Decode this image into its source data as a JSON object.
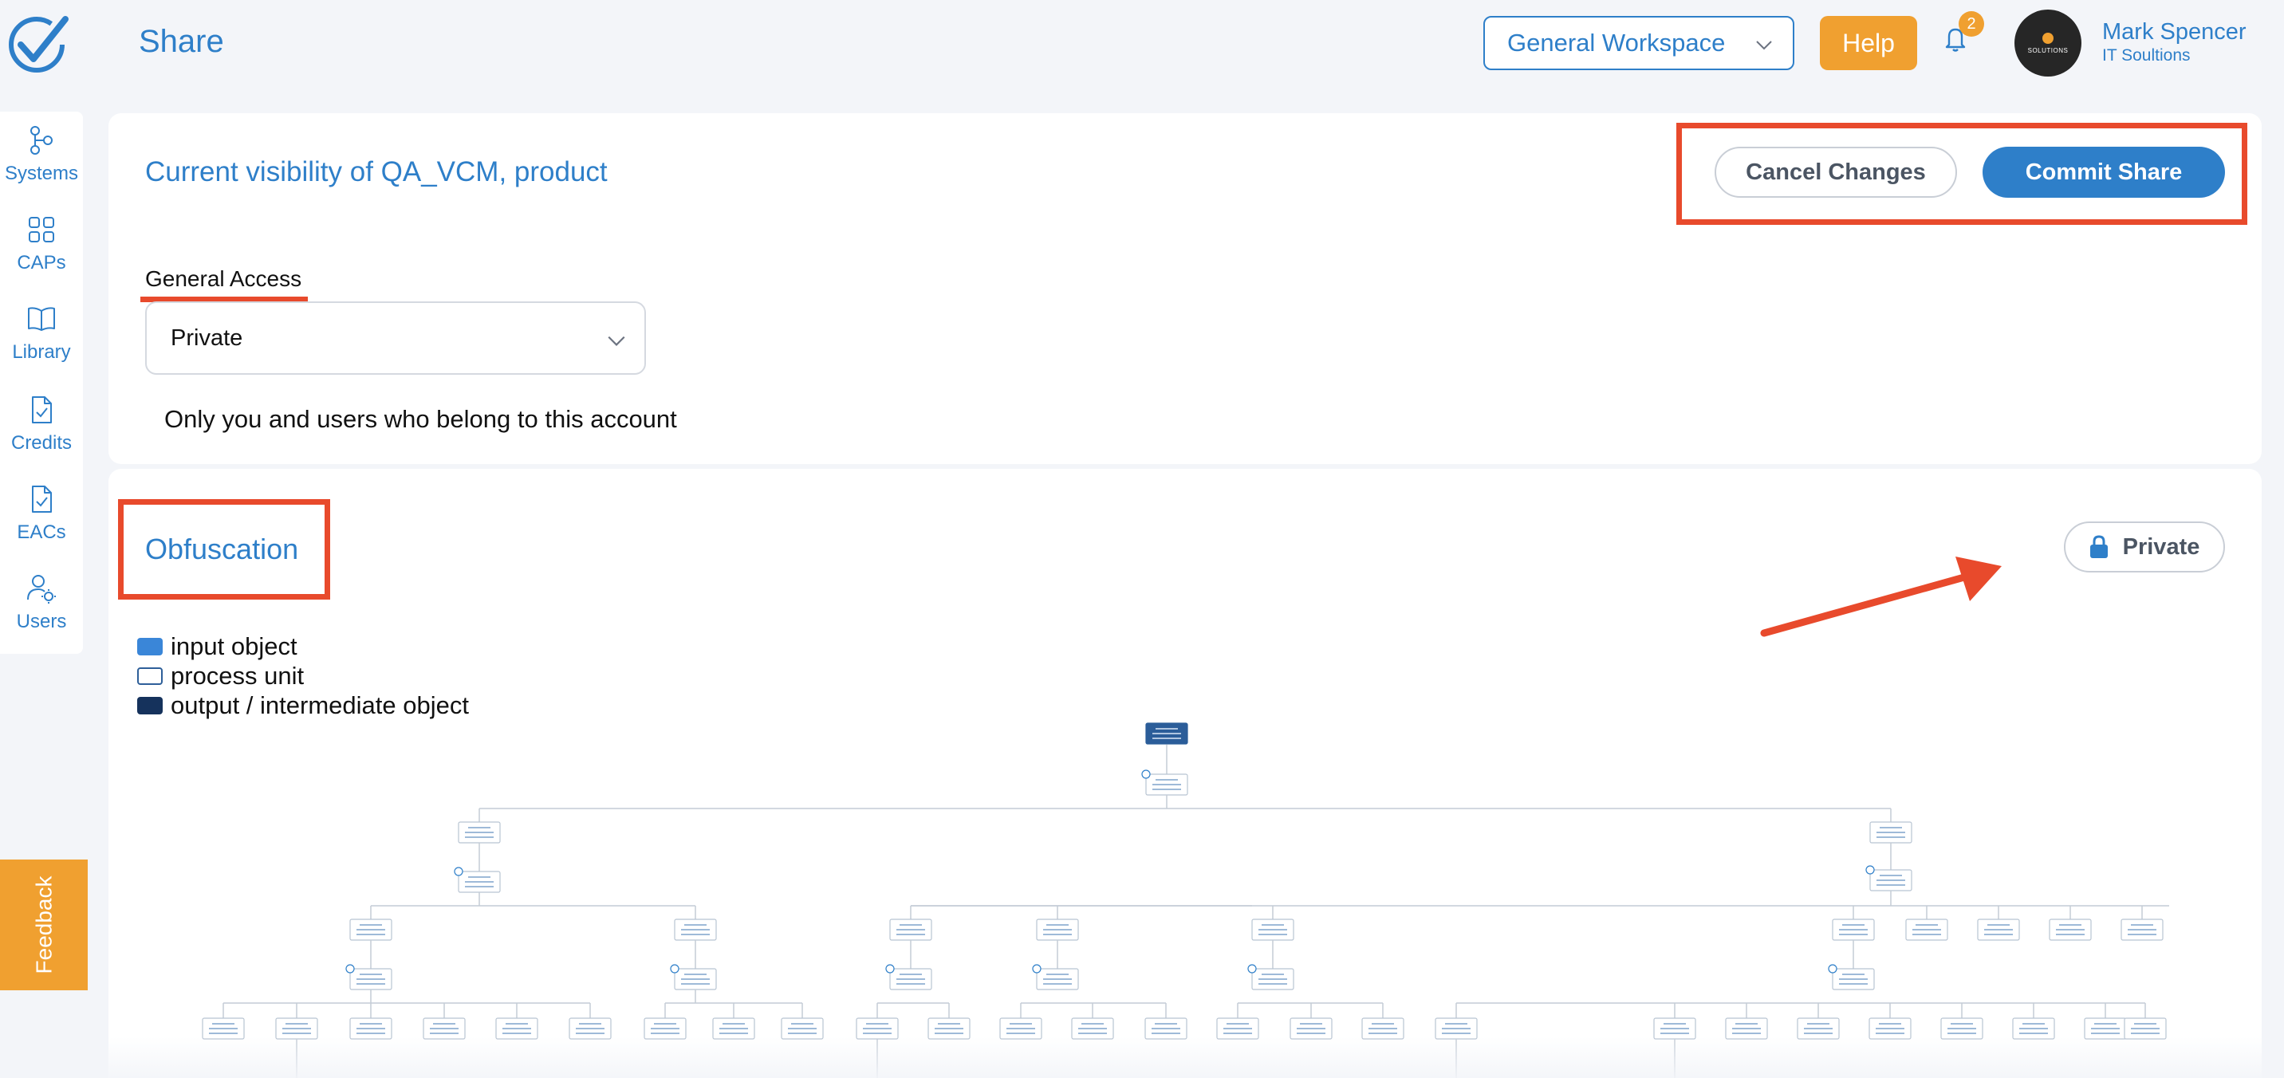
{
  "header": {
    "page_title": "Share",
    "workspace": "General Workspace",
    "help_label": "Help",
    "notification_count": "2",
    "user_name": "Mark Spencer",
    "user_org": "IT Soultions",
    "avatar_text": "SOLUTIONS"
  },
  "sidebar": {
    "items": [
      {
        "label": "Systems",
        "icon": "systems-icon"
      },
      {
        "label": "CAPs",
        "icon": "grid-icon"
      },
      {
        "label": "Library",
        "icon": "book-icon"
      },
      {
        "label": "Credits",
        "icon": "document-check-icon"
      },
      {
        "label": "EACs",
        "icon": "document-check-icon"
      },
      {
        "label": "Users",
        "icon": "user-settings-icon"
      }
    ],
    "feedback_label": "Feedback"
  },
  "visibility": {
    "title": "Current visibility of QA_VCM, product",
    "cancel_label": "Cancel Changes",
    "commit_label": "Commit Share",
    "general_access_label": "General Access",
    "access_value": "Private",
    "access_description": "Only you and users who belong to this account"
  },
  "obfuscation": {
    "title": "Obfuscation",
    "private_label": "Private",
    "legend": [
      {
        "label": "input object",
        "color": "#3a86d8"
      },
      {
        "label": "process unit",
        "color": "#ffffff"
      },
      {
        "label": "output / intermediate object",
        "color": "#15325c"
      }
    ]
  },
  "colors": {
    "accent": "#2e7fc9",
    "orange": "#f0a030",
    "annotation_red": "#e84a2c"
  }
}
